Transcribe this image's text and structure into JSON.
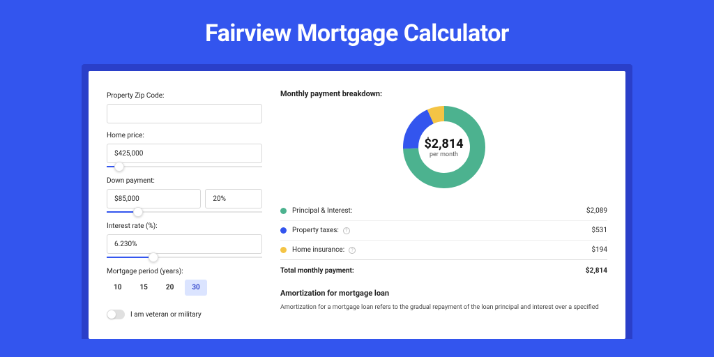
{
  "header": {
    "title": "Fairview Mortgage Calculator"
  },
  "form": {
    "zip": {
      "label": "Property Zip Code:",
      "value": ""
    },
    "price": {
      "label": "Home price:",
      "value": "$425,000",
      "slider_pct": 8
    },
    "down": {
      "label": "Down payment:",
      "amount": "$85,000",
      "percent": "20%",
      "slider_pct": 20
    },
    "rate": {
      "label": "Interest rate (%):",
      "value": "6.230%",
      "slider_pct": 30
    },
    "term": {
      "label": "Mortgage period (years):",
      "options": [
        "10",
        "15",
        "20",
        "30"
      ],
      "selected": "30"
    },
    "veteran": {
      "label": "I am veteran or military",
      "on": false
    }
  },
  "breakdown": {
    "title": "Monthly payment breakdown:",
    "center_value": "$2,814",
    "center_sub": "per month",
    "items": [
      {
        "label": "Principal & Interest:",
        "value": "$2,089",
        "color": "#4cb28f",
        "info": false
      },
      {
        "label": "Property taxes:",
        "value": "$531",
        "color": "#3355ee",
        "info": true
      },
      {
        "label": "Home insurance:",
        "value": "$194",
        "color": "#f4c445",
        "info": true
      }
    ],
    "total": {
      "label": "Total monthly payment:",
      "value": "$2,814"
    }
  },
  "amort": {
    "title": "Amortization for mortgage loan",
    "text": "Amortization for a mortgage loan refers to the gradual repayment of the loan principal and interest over a specified"
  },
  "chart_data": {
    "type": "pie",
    "title": "Monthly payment breakdown",
    "categories": [
      "Principal & Interest",
      "Property taxes",
      "Home insurance"
    ],
    "values": [
      2089,
      531,
      194
    ],
    "colors": [
      "#4cb28f",
      "#3355ee",
      "#f4c445"
    ],
    "total": 2814,
    "center_label": "$2,814 per month"
  }
}
